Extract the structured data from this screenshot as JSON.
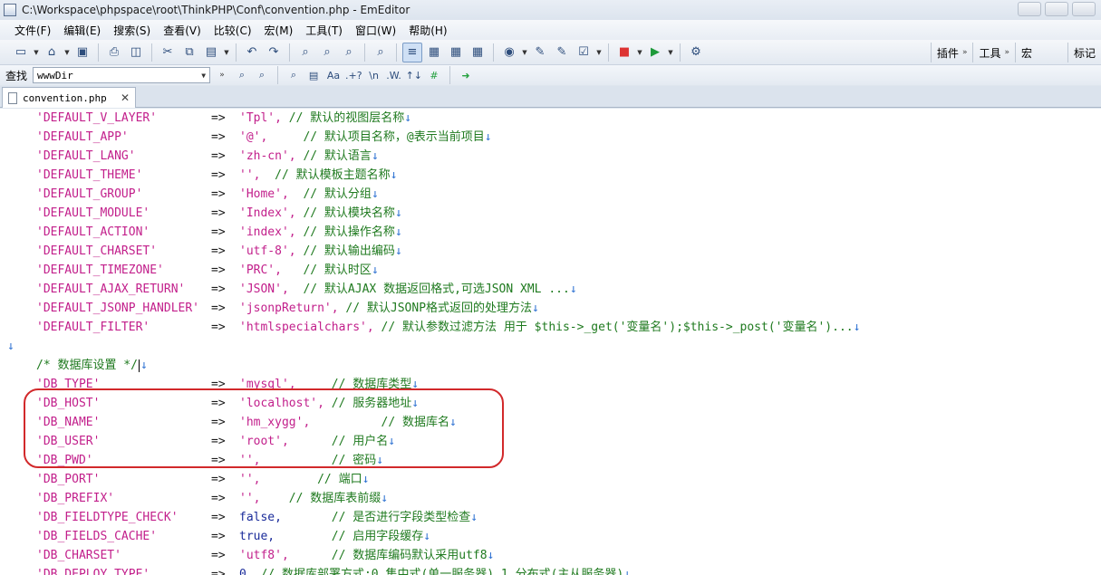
{
  "window": {
    "title": "C:\\Workspace\\phpspace\\root\\ThinkPHP\\Conf\\convention.php - EmEditor"
  },
  "menu": [
    "文件(F)",
    "编辑(E)",
    "搜索(S)",
    "查看(V)",
    "比较(C)",
    "宏(M)",
    "工具(T)",
    "窗口(W)",
    "帮助(H)"
  ],
  "toolbar": {
    "right_groups": [
      "插件",
      "工具",
      "宏",
      "标记"
    ]
  },
  "search": {
    "label": "查找",
    "value": "wwwDir",
    "buttons": [
      ".+?",
      "\\n",
      ".W.",
      "↑↓"
    ]
  },
  "tab": {
    "label": "convention.php",
    "close": "✕"
  },
  "newline_mark": "↓",
  "code": [
    {
      "key": "'DEFAULT_V_LAYER'",
      "arrow": "=>",
      "value": "'Tpl',",
      "comment": "// 默认的视图层名称"
    },
    {
      "key": "'DEFAULT_APP'",
      "arrow": "=>",
      "value": "'@',",
      "comment": "    // 默认项目名称，@表示当前项目"
    },
    {
      "key": "'DEFAULT_LANG'",
      "arrow": "=>",
      "value": "'zh-cn',",
      "comment": "// 默认语言"
    },
    {
      "key": "'DEFAULT_THEME'",
      "arrow": "=>",
      "value": "'',",
      "comment": " // 默认模板主题名称"
    },
    {
      "key": "'DEFAULT_GROUP'",
      "arrow": "=>",
      "value": "'Home',",
      "comment": " // 默认分组"
    },
    {
      "key": "'DEFAULT_MODULE'",
      "arrow": "=>",
      "value": "'Index',",
      "comment": "// 默认模块名称"
    },
    {
      "key": "'DEFAULT_ACTION'",
      "arrow": "=>",
      "value": "'index',",
      "comment": "// 默认操作名称"
    },
    {
      "key": "'DEFAULT_CHARSET'",
      "arrow": "=>",
      "value": "'utf-8',",
      "comment": "// 默认输出编码"
    },
    {
      "key": "'DEFAULT_TIMEZONE'",
      "arrow": "=>",
      "value": "'PRC',",
      "comment": "  // 默认时区"
    },
    {
      "key": "'DEFAULT_AJAX_RETURN'",
      "arrow": "=>",
      "value": "'JSON',",
      "comment": " // 默认AJAX 数据返回格式,可选JSON XML ..."
    },
    {
      "key": "'DEFAULT_JSONP_HANDLER'",
      "arrow": "=>",
      "value": "'jsonpReturn',",
      "comment": "// 默认JSONP格式返回的处理方法"
    },
    {
      "key": "'DEFAULT_FILTER'",
      "arrow": "=>",
      "value": "'htmlspecialchars',",
      "comment": "// 默认参数过滤方法 用于 $this->_get('变量名');$this->_post('变量名')..."
    },
    {
      "key": "",
      "arrow": "",
      "value": "",
      "comment": ""
    },
    {
      "key": "/* 数据库设置 */",
      "arrow": "",
      "value": "",
      "comment": ""
    },
    {
      "key": "'DB_TYPE'",
      "arrow": "=>",
      "value": "'mysql',",
      "comment": "    // 数据库类型"
    },
    {
      "key": "'DB_HOST'",
      "arrow": "=>",
      "value": "'localhost',",
      "comment": "// 服务器地址"
    },
    {
      "key": "'DB_NAME'",
      "arrow": "=>",
      "value": "'hm_xygg',",
      "comment": "         // 数据库名"
    },
    {
      "key": "'DB_USER'",
      "arrow": "=>",
      "value": "'root',",
      "comment": "     // 用户名"
    },
    {
      "key": "'DB_PWD'",
      "arrow": "=>",
      "value": "'',",
      "comment": "         // 密码"
    },
    {
      "key": "'DB_PORT'",
      "arrow": "=>",
      "value": "'',",
      "comment": "       // 端口"
    },
    {
      "key": "'DB_PREFIX'",
      "arrow": "=>",
      "value": "'',",
      "comment": "   // 数据库表前缀"
    },
    {
      "key": "'DB_FIELDTYPE_CHECK'",
      "arrow": "=>",
      "value": "false,",
      "comment": "      // 是否进行字段类型检查"
    },
    {
      "key": "'DB_FIELDS_CACHE'",
      "arrow": "=>",
      "value": "true,",
      "comment": "       // 启用字段缓存"
    },
    {
      "key": "'DB_CHARSET'",
      "arrow": "=>",
      "value": "'utf8',",
      "comment": "     // 数据库编码默认采用utf8"
    },
    {
      "key": "'DB_DEPLOY_TYPE'",
      "arrow": "=>",
      "value": "0,",
      "comment": "// 数据库部署方式:0 集中式(单一服务器),1 分布式(主从服务器)"
    }
  ]
}
